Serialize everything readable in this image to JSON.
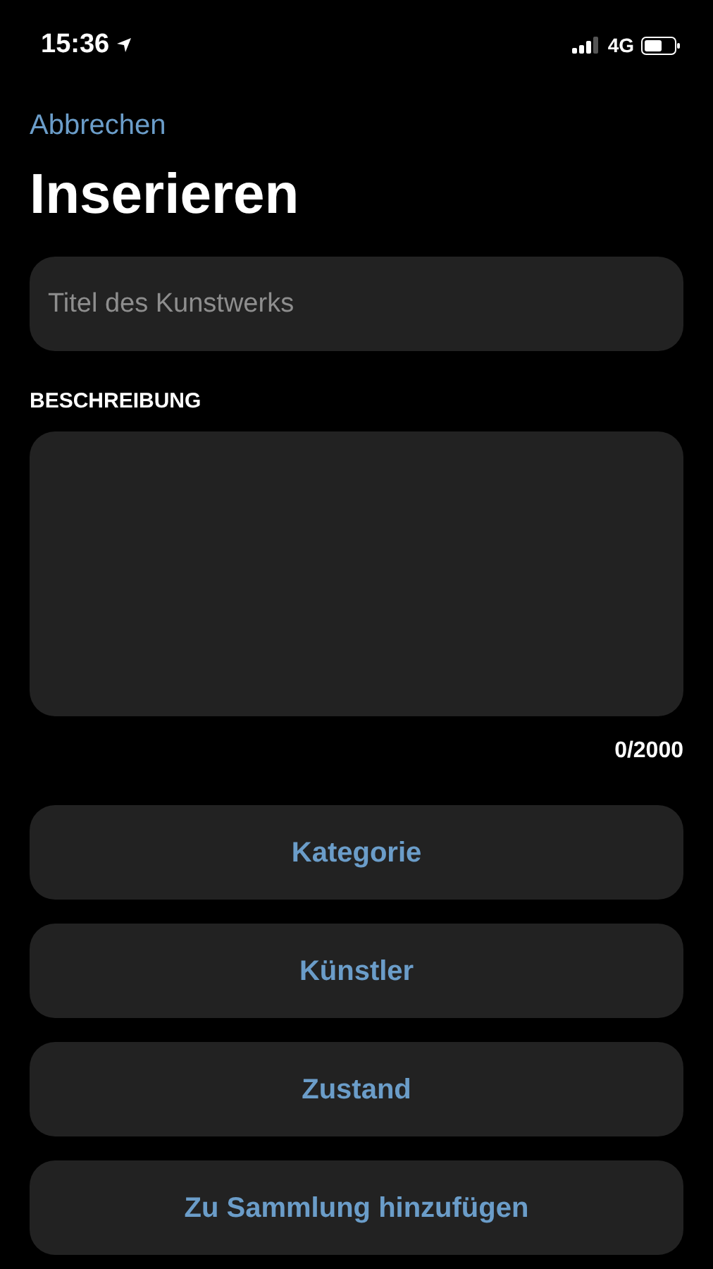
{
  "status_bar": {
    "time": "15:36",
    "network": "4G"
  },
  "nav": {
    "cancel": "Abbrechen",
    "title": "Inserieren"
  },
  "title_field": {
    "placeholder": "Titel des Kunstwerks"
  },
  "description": {
    "label": "BESCHREIBUNG",
    "counter": "0/2000"
  },
  "buttons": [
    "Kategorie",
    "Künstler",
    "Zustand",
    "Zu Sammlung hinzufügen"
  ]
}
